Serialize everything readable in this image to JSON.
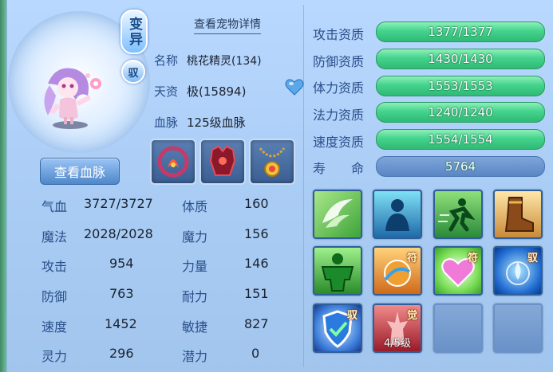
{
  "pet": {
    "view_details_link": "查看宠物详情",
    "badge_variant": "变异",
    "badge_yu": "驭",
    "name_label": "名称",
    "name_value": "桃花精灵(134)",
    "aptitude_label": "天资",
    "aptitude_value": "极(15894)",
    "bloodline_label": "血脉",
    "bloodline_value": "125级血脉",
    "view_bloodline_button": "查看血脉"
  },
  "equipment": [
    "red-ring-icon",
    "red-armor-icon",
    "gold-necklace-icon"
  ],
  "stats": [
    {
      "label": "气血",
      "value": "3727/3727"
    },
    {
      "label": "魔法",
      "value": "2028/2028"
    },
    {
      "label": "攻击",
      "value": "954"
    },
    {
      "label": "防御",
      "value": "763"
    },
    {
      "label": "速度",
      "value": "1452"
    },
    {
      "label": "灵力",
      "value": "296"
    }
  ],
  "attributes": [
    {
      "label": "体质",
      "value": "160"
    },
    {
      "label": "魔力",
      "value": "156"
    },
    {
      "label": "力量",
      "value": "146"
    },
    {
      "label": "耐力",
      "value": "151"
    },
    {
      "label": "敏捷",
      "value": "827"
    },
    {
      "label": "潜力",
      "value": "0"
    }
  ],
  "qualifications": [
    {
      "label": "攻击资质",
      "value": "1377/1377",
      "fill": 1.0
    },
    {
      "label": "防御资质",
      "value": "1430/1430",
      "fill": 1.0
    },
    {
      "label": "体力资质",
      "value": "1553/1553",
      "fill": 1.0
    },
    {
      "label": "法力资质",
      "value": "1240/1240",
      "fill": 1.0
    },
    {
      "label": "速度资质",
      "value": "1554/1554",
      "fill": 1.0
    }
  ],
  "life": {
    "label_1": "寿",
    "label_2": "命",
    "value": "5764"
  },
  "skills": [
    {
      "icon": "white-wings-icon",
      "tag": ""
    },
    {
      "icon": "blue-silhouette-icon",
      "tag": ""
    },
    {
      "icon": "green-runner-icon",
      "tag": ""
    },
    {
      "icon": "brown-boot-icon",
      "tag": ""
    },
    {
      "icon": "green-strongman-icon",
      "tag": ""
    },
    {
      "icon": "orange-orb-icon",
      "tag": "符"
    },
    {
      "icon": "pink-heart-icon",
      "tag": "符"
    },
    {
      "icon": "blue-water-icon",
      "tag": "驭"
    },
    {
      "icon": "blue-shield-icon",
      "tag": "驭"
    },
    {
      "icon": "red-awaken-icon",
      "tag": "觉",
      "level": "4/5级"
    }
  ],
  "colors": {
    "panel": "#afd0f7",
    "bar_green": "#3fcb85",
    "label_blue": "#2a4f8a"
  }
}
